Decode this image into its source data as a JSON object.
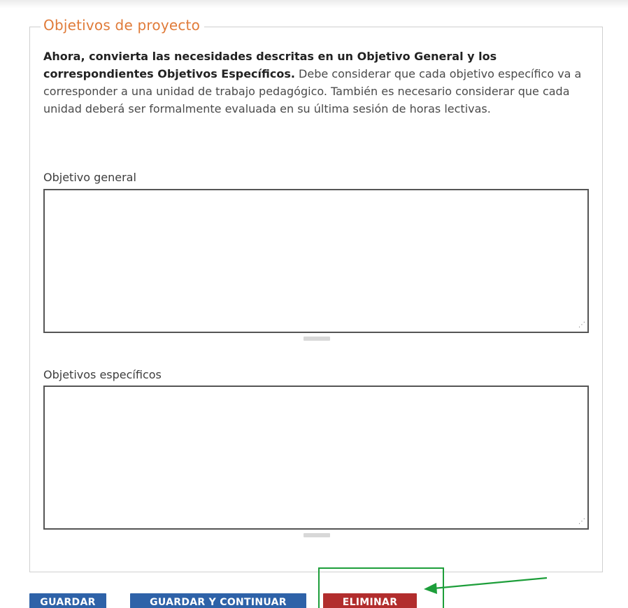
{
  "section": {
    "legend": "Objetivos de proyecto",
    "intro_bold": "Ahora, convierta las necesidades descritas en un Objetivo General y los correspondientes Objetivos Específicos.",
    "intro_rest": " Debe considerar que cada objetivo específico va a corresponder a una unidad de trabajo pedagógico. También es necesario considerar que cada unidad deberá ser formalmente evaluada en su última sesión de horas lectivas."
  },
  "fields": {
    "general": {
      "label": "Objetivo general",
      "value": ""
    },
    "especificos": {
      "label": "Objetivos específicos",
      "value": ""
    }
  },
  "buttons": {
    "guardar": "GUARDAR",
    "guardar_continuar": "GUARDAR Y CONTINUAR",
    "eliminar": "ELIMINAR"
  },
  "colors": {
    "legend": "#e07b39",
    "button_primary": "#2e62a8",
    "button_danger": "#b22d2d",
    "annotation": "#1d9e3a"
  },
  "annotation": {
    "icon": "arrow-left-icon"
  }
}
